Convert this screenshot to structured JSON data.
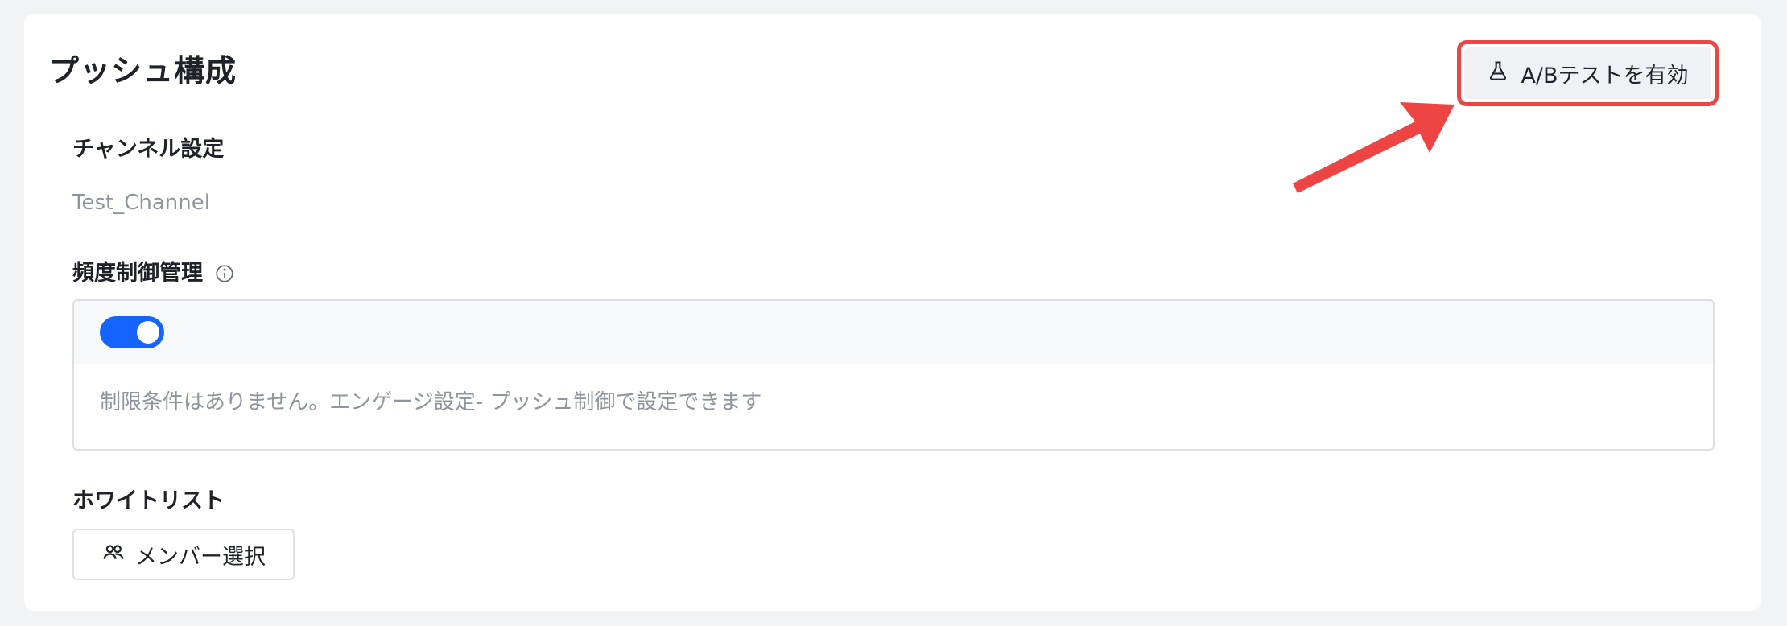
{
  "header": {
    "title": "プッシュ構成",
    "ab_test_button": {
      "label": "A/Bテストを有効",
      "icon": "flask-icon"
    }
  },
  "channel": {
    "label": "チャンネル設定",
    "value": "Test_Channel"
  },
  "frequency": {
    "label": "頻度制御管理",
    "info_icon": "info-icon",
    "toggle_on": true,
    "description": "制限条件はありません。エンゲージ設定- プッシュ制御で設定できます"
  },
  "whitelist": {
    "label": "ホワイトリスト",
    "member_button": {
      "label": "メンバー選択",
      "icon": "users-icon"
    }
  },
  "colors": {
    "highlight": "#ef4444",
    "toggle_on": "#1664ff",
    "muted_text": "#8f959e"
  }
}
